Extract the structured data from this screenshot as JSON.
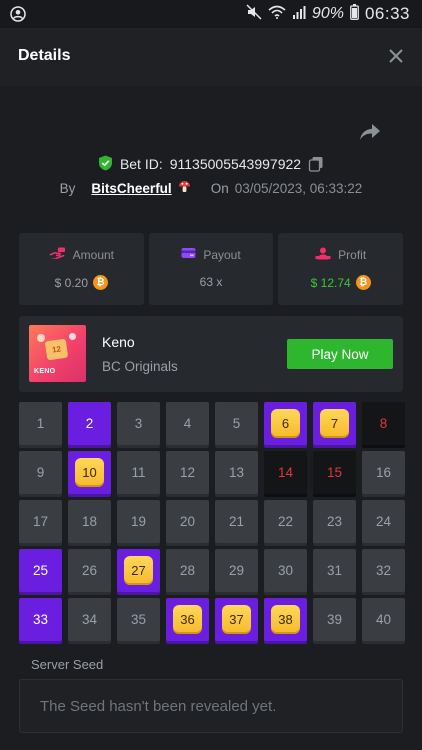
{
  "status_bar": {
    "battery": "90%",
    "time": "06:33"
  },
  "header": {
    "title": "Details"
  },
  "bet": {
    "bet_id_label": "Bet ID:",
    "bet_id": "91135005543997922",
    "by_label": "By",
    "username": "BitsCheerful",
    "on_label": "On",
    "date": "03/05/2023, 06:33:22"
  },
  "stats": {
    "amount_label": "Amount",
    "amount_value": "$ 0.20",
    "payout_label": "Payout",
    "payout_value": "63 x",
    "profit_label": "Profit",
    "profit_value": "$ 12.74"
  },
  "game": {
    "thumb_number": "12",
    "thumb_logo": "KENO",
    "name": "Keno",
    "provider": "BC Originals",
    "play_label": "Play Now"
  },
  "grid": {
    "cells": [
      {
        "n": "1",
        "state": "normal"
      },
      {
        "n": "2",
        "state": "selected"
      },
      {
        "n": "3",
        "state": "normal"
      },
      {
        "n": "4",
        "state": "normal"
      },
      {
        "n": "5",
        "state": "normal"
      },
      {
        "n": "6",
        "state": "hit"
      },
      {
        "n": "7",
        "state": "hit"
      },
      {
        "n": "8",
        "state": "miss"
      },
      {
        "n": "9",
        "state": "normal"
      },
      {
        "n": "10",
        "state": "hit"
      },
      {
        "n": "11",
        "state": "normal"
      },
      {
        "n": "12",
        "state": "normal"
      },
      {
        "n": "13",
        "state": "normal"
      },
      {
        "n": "14",
        "state": "miss"
      },
      {
        "n": "15",
        "state": "miss"
      },
      {
        "n": "16",
        "state": "normal"
      },
      {
        "n": "17",
        "state": "normal"
      },
      {
        "n": "18",
        "state": "normal"
      },
      {
        "n": "19",
        "state": "normal"
      },
      {
        "n": "20",
        "state": "normal"
      },
      {
        "n": "21",
        "state": "normal"
      },
      {
        "n": "22",
        "state": "normal"
      },
      {
        "n": "23",
        "state": "normal"
      },
      {
        "n": "24",
        "state": "normal"
      },
      {
        "n": "25",
        "state": "selected"
      },
      {
        "n": "26",
        "state": "normal"
      },
      {
        "n": "27",
        "state": "hit"
      },
      {
        "n": "28",
        "state": "normal"
      },
      {
        "n": "29",
        "state": "normal"
      },
      {
        "n": "30",
        "state": "normal"
      },
      {
        "n": "31",
        "state": "normal"
      },
      {
        "n": "32",
        "state": "normal"
      },
      {
        "n": "33",
        "state": "selected"
      },
      {
        "n": "34",
        "state": "normal"
      },
      {
        "n": "35",
        "state": "normal"
      },
      {
        "n": "36",
        "state": "hit"
      },
      {
        "n": "37",
        "state": "hit"
      },
      {
        "n": "38",
        "state": "hit"
      },
      {
        "n": "39",
        "state": "normal"
      },
      {
        "n": "40",
        "state": "normal"
      }
    ]
  },
  "seed": {
    "label": "Server Seed",
    "value": "The Seed hasn't been revealed yet."
  },
  "colors": {
    "background": "#1b1d20",
    "card": "#26292d",
    "cell": "#3a3e43",
    "selected": "#6a1fe0",
    "hit_gem": "#f6b92b",
    "miss_text": "#e0363b",
    "play_button": "#2fb62f",
    "profit": "#3cc63c",
    "bitcoin": "#f7931a"
  }
}
